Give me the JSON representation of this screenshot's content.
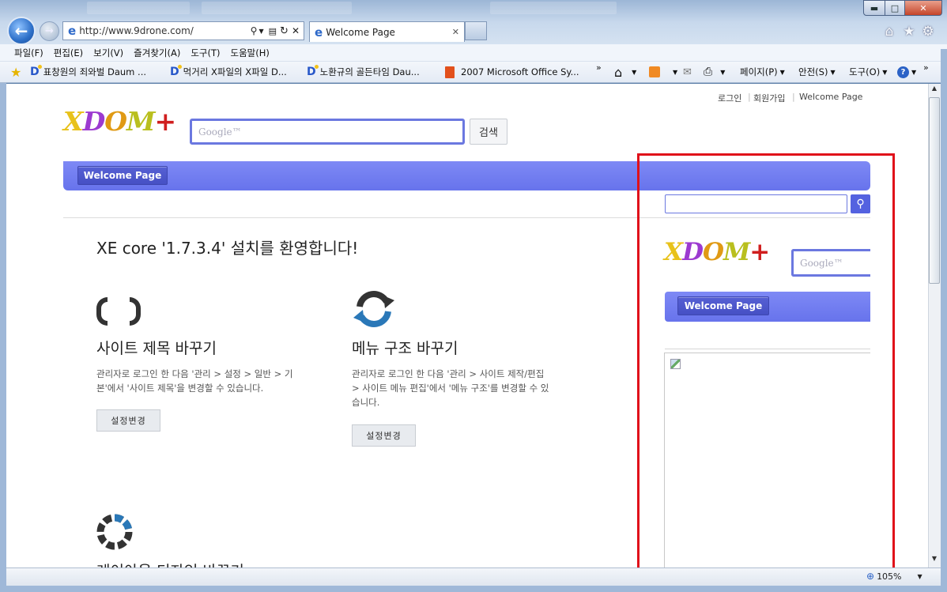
{
  "browser": {
    "address": "http://www.9drone.com/",
    "tab_title": "Welcome Page",
    "menu": [
      "파일(F)",
      "편집(E)",
      "보기(V)",
      "즐겨찾기(A)",
      "도구(T)",
      "도움말(H)"
    ],
    "favorites": [
      "표창원의 죄와벌  Daum ...",
      "먹거리 X파일의 X파일  D...",
      "노환규의 골든타임  Dau...",
      "2007 Microsoft Office Sy..."
    ],
    "commands": {
      "page": "페이지(P)",
      "safety": "안전(S)",
      "tools": "도구(O)"
    },
    "zoom": "105%"
  },
  "page": {
    "top_links": {
      "login": "로그인",
      "signup": "회원가입",
      "welcome": "Welcome Page"
    },
    "logo": {
      "x": "X",
      "d": "D",
      "o": "O",
      "m": "M",
      "plus": "+"
    },
    "search_placeholder": "Google™",
    "search_button": "검색",
    "nav_item": "Welcome Page",
    "heading": "XE core '1.7.3.4' 설치를 환영합니다!",
    "features": [
      {
        "title": "사이트 제목 바꾸기",
        "desc1": "관리자로 로그인 한 다음 '관리 > 설정 > 일반 > 기",
        "desc2": "본'에서 '사이트 제목'을 변경할 수 있습니다.",
        "button": "설정변경"
      },
      {
        "title": "메뉴 구조 바꾸기",
        "desc1": "관리자로 로그인 한 다음 '관리 > 사이트 제작/편집",
        "desc2": "> 사이트 메뉴 편집'에서 '메뉴 구조'를 변경할 수 있",
        "desc3": "습니다.",
        "button": "설정변경"
      },
      {
        "title": "레이아웃 디자인 바꾸기"
      }
    ],
    "sidebar": {
      "nav_item": "Welcome Page",
      "search_placeholder": "Google™"
    }
  },
  "colors": {
    "nav": "#6c78ee",
    "highlight": "#e0101a",
    "search_border": "#6b78e0"
  }
}
